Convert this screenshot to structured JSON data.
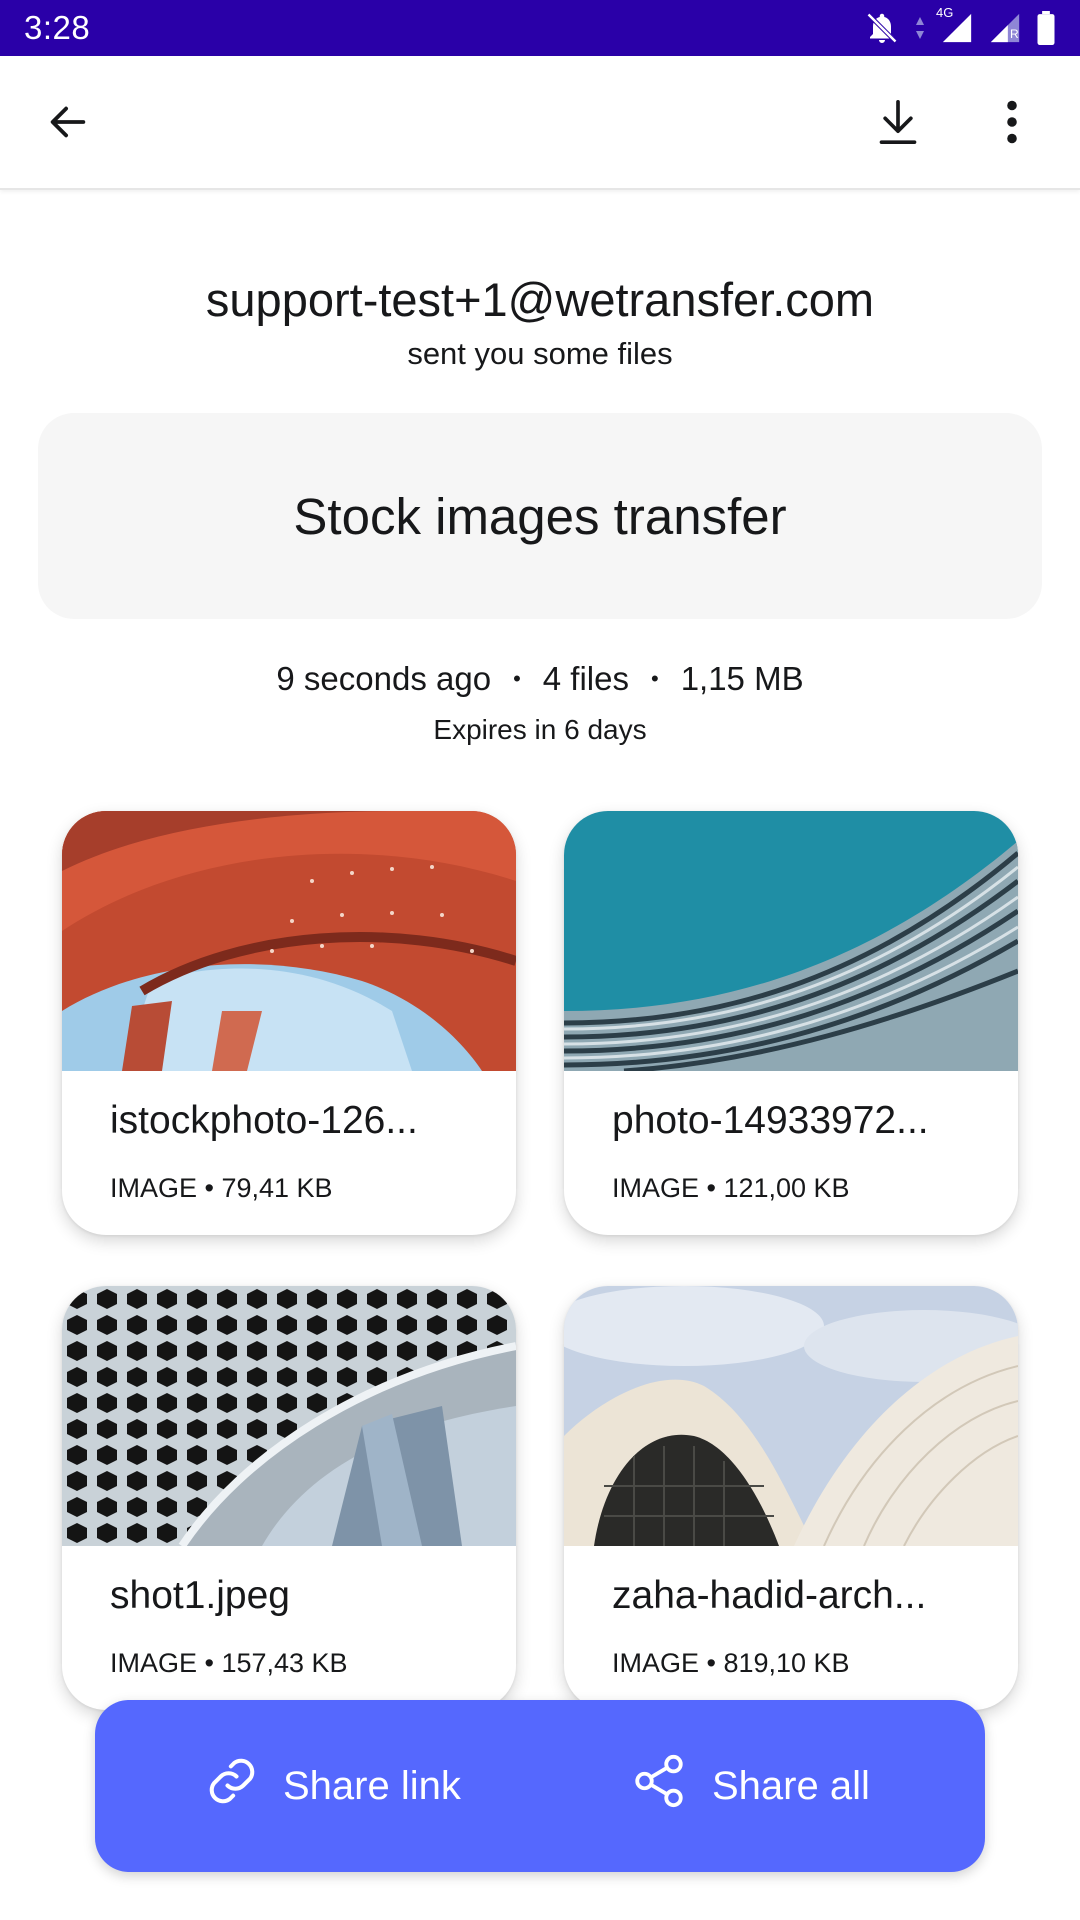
{
  "status_bar": {
    "time": "3:28",
    "network_label": "4G",
    "roaming_label": "R",
    "bg_color": "#2a00a8",
    "icons": [
      "bell-off-icon",
      "data-arrows-icon",
      "signal-icon",
      "signal-roaming-icon",
      "battery-icon"
    ]
  },
  "app_bar": {
    "back_icon": "arrow-left-icon",
    "download_icon": "download-icon",
    "more_icon": "more-vertical-icon"
  },
  "transfer": {
    "sender": "support-test+1@wetransfer.com",
    "sender_subtitle": "sent you some files",
    "message": "Stock images transfer",
    "time_ago": "9 seconds ago",
    "file_count": "4 files",
    "total_size": "1,15 MB",
    "separator": "•",
    "expires": "Expires in 6 days"
  },
  "files": [
    {
      "name": "istockphoto-126...",
      "meta": "IMAGE • 79,41 KB",
      "thumb": "red-architecture-curve"
    },
    {
      "name": "photo-14933972...",
      "meta": "IMAGE • 121,00 KB",
      "thumb": "blue-sky-woven-facade"
    },
    {
      "name": "shot1.jpeg",
      "meta": "IMAGE • 157,43 KB",
      "thumb": "hexagon-perforated-tunnel"
    },
    {
      "name": "zaha-hadid-arch...",
      "meta": "IMAGE • 819,10 KB",
      "thumb": "white-wave-building"
    }
  ],
  "share_bar": {
    "share_link_label": "Share link",
    "share_all_label": "Share all",
    "bg_color": "#5568fe"
  }
}
